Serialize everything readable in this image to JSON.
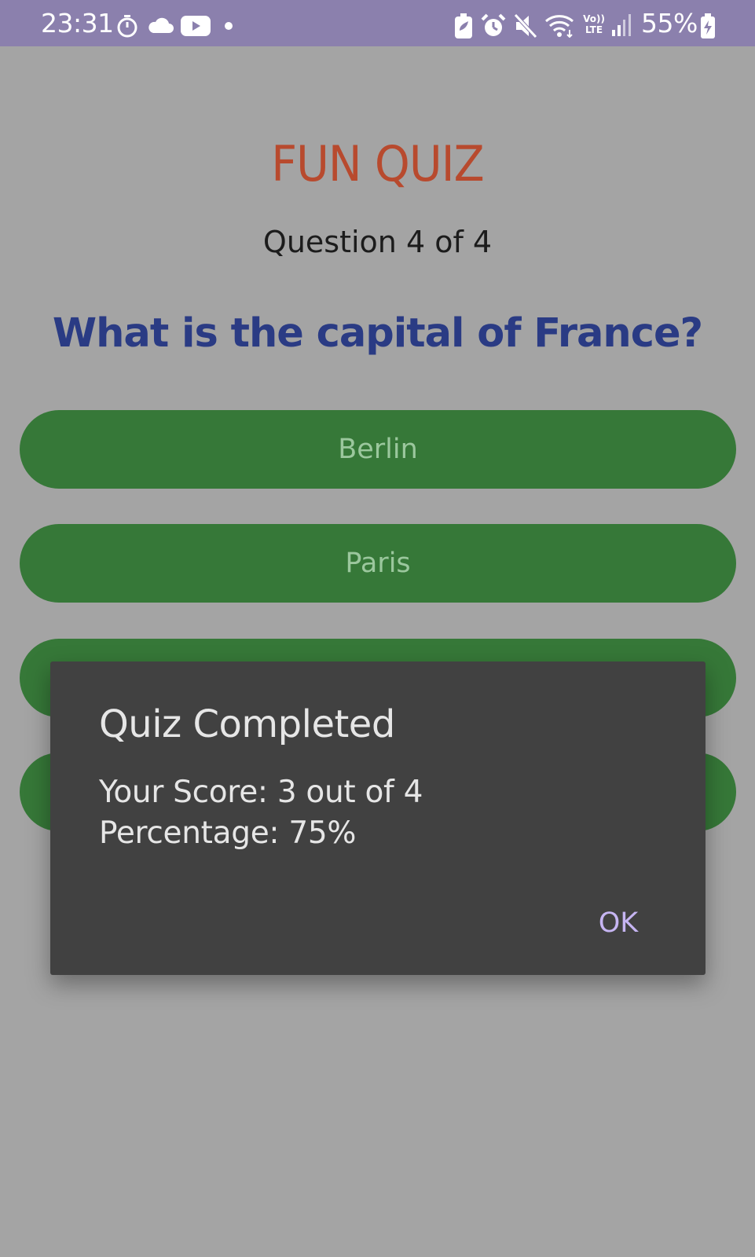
{
  "status_bar": {
    "time": "23:31",
    "battery": "55%",
    "icons_left": [
      "timer-icon",
      "cloud-icon",
      "youtube-icon",
      "notification-dot-icon"
    ],
    "icons_right": [
      "battery-saver-icon",
      "alarm-icon",
      "mute-icon",
      "wifi-icon",
      "volte-icon",
      "signal-icon",
      "battery-charging-icon"
    ],
    "volte_label_top": "Vo))",
    "volte_label_bottom": "LTE"
  },
  "quiz": {
    "title": "FUN QUIZ",
    "progress": "Question 4 of 4",
    "question": "What is the capital of France?",
    "options": [
      "Berlin",
      "Paris",
      "",
      ""
    ]
  },
  "dialog": {
    "title": "Quiz Completed",
    "score_line": "Your Score: 3 out of 4",
    "percentage_line": "Percentage: 75%",
    "ok_label": "OK"
  },
  "colors": {
    "status_bar": "#8b80ad",
    "background": "#a4a4a4",
    "title": "#b84a2e",
    "question": "#2a3b84",
    "option_bg": "#367838",
    "dialog_bg": "#414141",
    "dialog_button": "#c6b5f2"
  }
}
